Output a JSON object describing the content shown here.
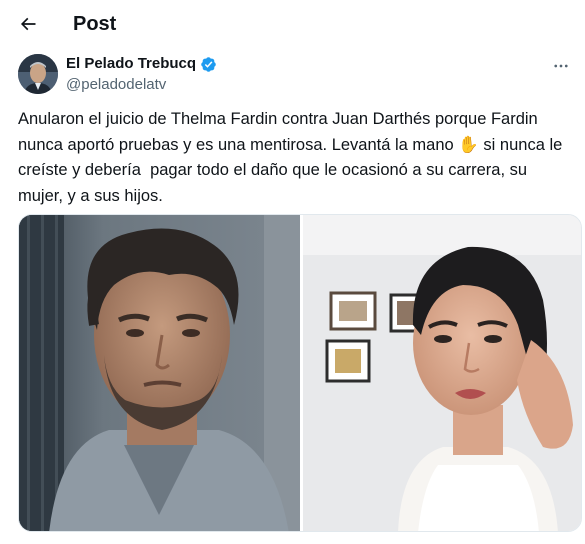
{
  "header": {
    "title": "Post",
    "back_icon": "arrow-left-icon"
  },
  "author": {
    "display_name": "El Pelado Trebucq",
    "handle": "@peladodelatv",
    "verified": true,
    "verified_color": "#1d9bf0",
    "more_icon": "more-horizontal-icon"
  },
  "tweet": {
    "text": "Anularon el juicio de Thelma Fardin contra Juan Darthés porque Fardin nunca aportó pruebas y es una mentirosa. Levantá la mano ✋ si nunca le creíste y debería  pagar todo el daño que le ocasionó a su carrera, su mujer, y a sus hijos."
  },
  "media": {
    "count": 2,
    "images": [
      "man-portrait-photo",
      "woman-selfie-photo"
    ]
  }
}
